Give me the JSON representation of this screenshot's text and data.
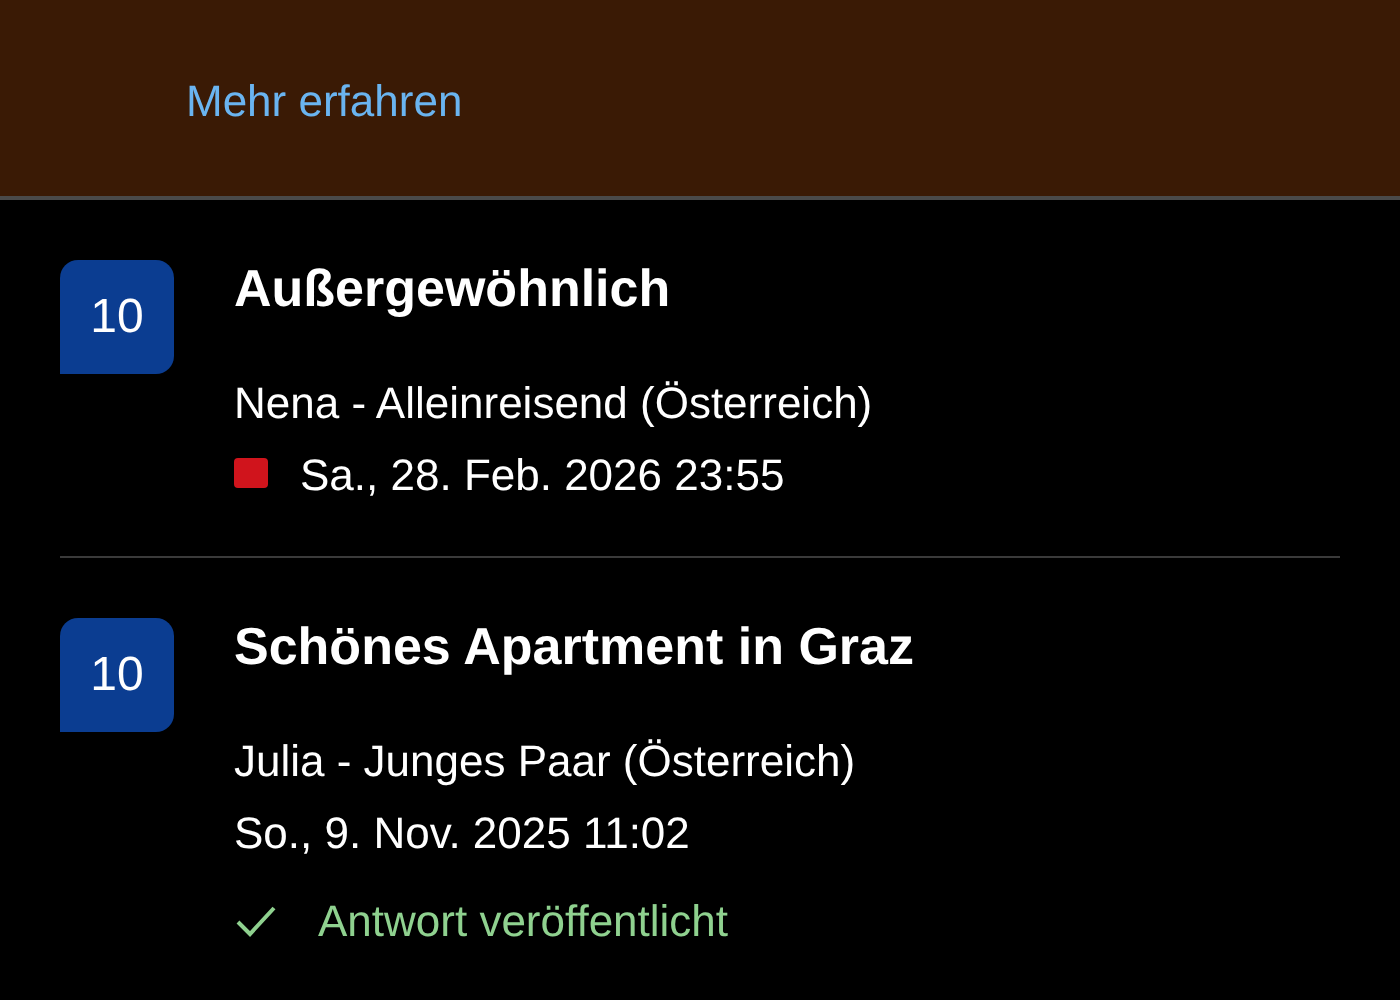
{
  "banner": {
    "link": "Mehr erfahren"
  },
  "reviews": [
    {
      "score": "10",
      "title": "Außergewöhnlich",
      "guest": "Nena - Alleinreisend (Österreich)",
      "date": "Sa., 28. Feb. 2026 23:55",
      "flagged": true
    },
    {
      "score": "10",
      "title": "Schönes Apartment in Graz",
      "guest": "Julia - Junges Paar (Österreich)",
      "date": "So., 9. Nov. 2025 11:02",
      "flagged": false,
      "response": "Antwort veröffentlicht"
    }
  ]
}
